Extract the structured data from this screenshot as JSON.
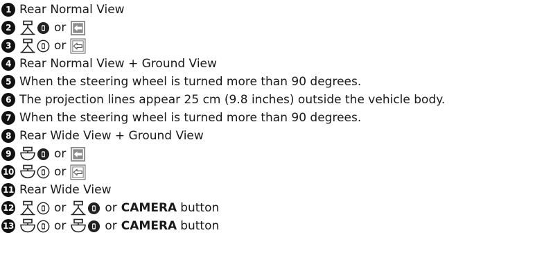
{
  "legend": {
    "items": [
      {
        "num": "1",
        "text": "Rear Normal View"
      },
      {
        "num": "2",
        "or": "or"
      },
      {
        "num": "3",
        "or": "or"
      },
      {
        "num": "4",
        "text": "Rear Normal View + Ground View"
      },
      {
        "num": "5",
        "text": "When the steering wheel is turned more than 90 degrees."
      },
      {
        "num": "6",
        "text": "The projection lines appear 25 cm (9.8 inches) outside the vehicle body."
      },
      {
        "num": "7",
        "text": "When the steering wheel is turned more than 90 degrees."
      },
      {
        "num": "8",
        "text": "Rear Wide View + Ground View"
      },
      {
        "num": "9",
        "or": "or"
      },
      {
        "num": "10",
        "or": "or"
      },
      {
        "num": "11",
        "text": "Rear Wide View"
      },
      {
        "num": "12",
        "or1": "or",
        "or2": "or",
        "button_bold": "CAMERA",
        "button_word": "button"
      },
      {
        "num": "13",
        "or1": "or",
        "or2": "or",
        "button_bold": "CAMERA",
        "button_word": "button"
      }
    ]
  }
}
